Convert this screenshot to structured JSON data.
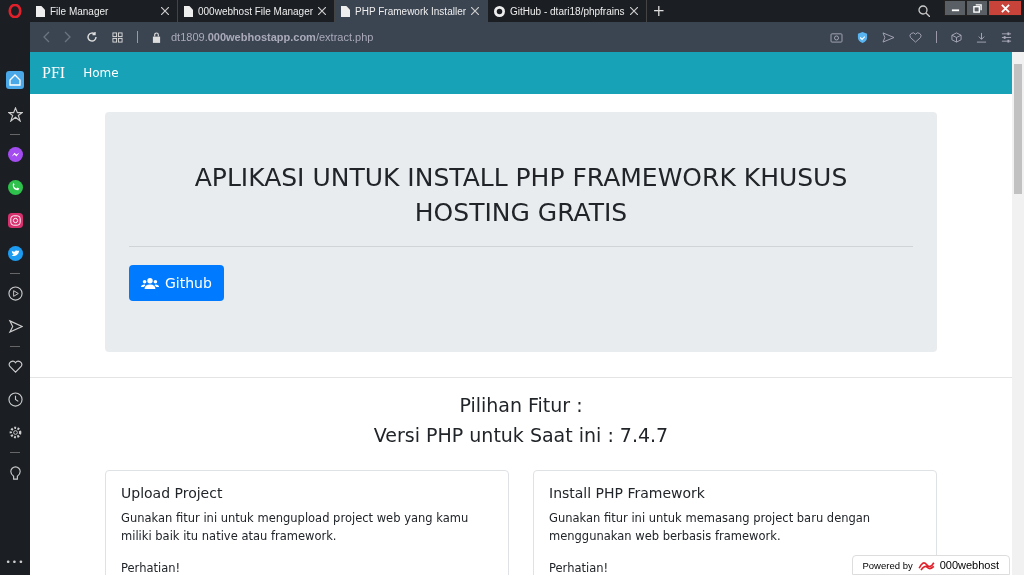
{
  "browser": {
    "tabs": [
      {
        "title": "File Manager",
        "kind": "page",
        "selected": false
      },
      {
        "title": "000webhost File Manager",
        "kind": "page",
        "selected": false
      },
      {
        "title": "PHP Framework Installer",
        "kind": "page",
        "selected": true
      },
      {
        "title": "GitHub - dtari18/phpfrains",
        "kind": "github",
        "selected": false
      }
    ],
    "new_tab": "+",
    "url": "dt1809.**000webhostapp.com**/extract.php",
    "sidebar": [
      {
        "kind": "home",
        "selected": true
      },
      {
        "kind": "star",
        "selected": false
      },
      {
        "kind": "sep"
      },
      {
        "kind": "messenger",
        "selected": false
      },
      {
        "kind": "whatsapp",
        "selected": false
      },
      {
        "kind": "instagram",
        "selected": false
      },
      {
        "kind": "twitter",
        "selected": false
      },
      {
        "kind": "sep"
      },
      {
        "kind": "player",
        "selected": false
      },
      {
        "kind": "send",
        "selected": false
      },
      {
        "kind": "sep"
      },
      {
        "kind": "heart",
        "selected": false
      },
      {
        "kind": "clock",
        "selected": false
      },
      {
        "kind": "gear",
        "selected": false
      },
      {
        "kind": "sep"
      },
      {
        "kind": "bulb",
        "selected": false
      }
    ],
    "more": "•••"
  },
  "navbar": {
    "brand": "PFI",
    "links": [
      "Home"
    ]
  },
  "jumbotron": {
    "title": "APLIKASI UNTUK INSTALL PHP FRAMEWORK KHUSUS HOSTING GRATIS",
    "button": "Github"
  },
  "features": {
    "heading": "Pilihan Fitur :",
    "subheading": "Versi PHP untuk Saat ini : 7.4.7",
    "cards": [
      {
        "title": "Upload Project",
        "text": "Gunakan fitur ini untuk mengupload project web yang kamu miliki baik itu native atau framework.",
        "note": "Perhatian!"
      },
      {
        "title": "Install PHP Framework",
        "text": "Gunakan fitur ini untuk memasang project baru dengan menggunakan web berbasis framework.",
        "note": "Perhatian!"
      }
    ]
  },
  "badge": {
    "prefix": "Powered by",
    "brand": "000webhost"
  }
}
